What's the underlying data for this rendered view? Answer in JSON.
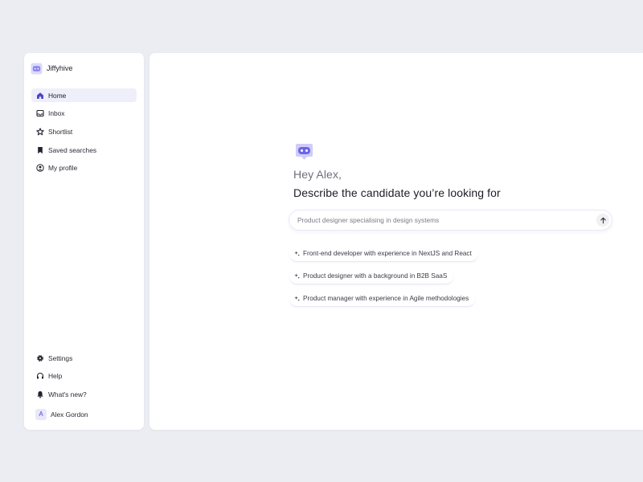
{
  "brand": {
    "name": "Jiffyhive",
    "logo_icon": "robot-logo-icon"
  },
  "nav": {
    "items": [
      {
        "label": "Home",
        "icon": "home-icon",
        "active": true
      },
      {
        "label": "Inbox",
        "icon": "inbox-icon",
        "active": false
      },
      {
        "label": "Shortlist",
        "icon": "shortlist-icon",
        "active": false
      },
      {
        "label": "Saved searches",
        "icon": "bookmark-icon",
        "active": false
      },
      {
        "label": "My profile",
        "icon": "user-circle-icon",
        "active": false
      }
    ],
    "bottom_items": [
      {
        "label": "Settings",
        "icon": "gear-icon"
      },
      {
        "label": "Help",
        "icon": "headset-icon"
      },
      {
        "label": "What's new?",
        "icon": "bell-icon"
      }
    ]
  },
  "user": {
    "initial": "A",
    "name": "Alex Gordon"
  },
  "main": {
    "greeting": "Hey Alex,",
    "headline": "Describe the candidate you’re looking for",
    "search": {
      "placeholder": "Product designer specialising in design systems",
      "send_icon": "arrow-up-icon"
    },
    "suggestions": [
      "Front-end developer with experience in NextJS and React",
      "Product designer with a background in B2B SaaS",
      "Product manager with experience in Agile methodologies"
    ]
  },
  "colors": {
    "background": "#ecedf3",
    "panel": "#ffffff",
    "accent": "#4b47c8",
    "active_nav": "#efeffb"
  }
}
